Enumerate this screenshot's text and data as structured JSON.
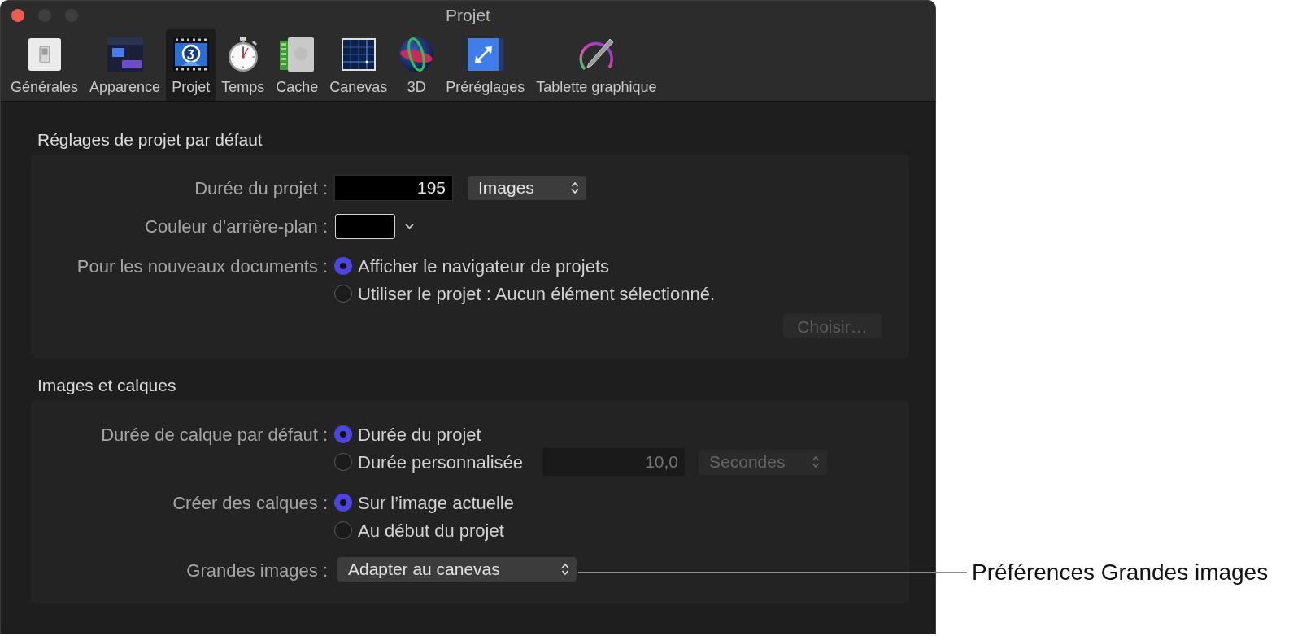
{
  "window": {
    "title": "Projet"
  },
  "toolbar": {
    "items": [
      {
        "label": "Générales",
        "selected": false
      },
      {
        "label": "Apparence",
        "selected": false
      },
      {
        "label": "Projet",
        "selected": true
      },
      {
        "label": "Temps",
        "selected": false
      },
      {
        "label": "Cache",
        "selected": false
      },
      {
        "label": "Canevas",
        "selected": false
      },
      {
        "label": "3D",
        "selected": false
      },
      {
        "label": "Préréglages",
        "selected": false
      },
      {
        "label": "Tablette graphique",
        "selected": false
      }
    ]
  },
  "sections": [
    {
      "title": "Réglages de projet par défaut",
      "rows": [
        {
          "kind": "number",
          "label": "Durée du projet :",
          "field": {
            "value": "195",
            "disabled": false
          },
          "popup": {
            "value": "Images",
            "disabled": false
          }
        },
        {
          "kind": "color",
          "label": "Couleur d’arrière-plan :",
          "color": "#000000"
        },
        {
          "kind": "radio",
          "label": "Pour les nouveaux documents :",
          "options": [
            {
              "label": "Afficher le navigateur de projets",
              "selected": true
            },
            {
              "label": "Utiliser le projet : Aucun élément sélectionné.",
              "selected": false
            }
          ],
          "button": {
            "label": "Choisir…",
            "disabled": true
          }
        }
      ]
    },
    {
      "title": "Images et calques",
      "rows": [
        {
          "kind": "radio",
          "label": "Durée de calque par défaut :",
          "options": [
            {
              "label": "Durée du projet",
              "selected": true
            },
            {
              "label": "Durée personnalisée",
              "selected": false,
              "field": {
                "value": "10,0",
                "disabled": true
              },
              "popup": {
                "value": "Secondes",
                "disabled": true
              }
            }
          ]
        },
        {
          "kind": "radio",
          "label": "Créer des calques :",
          "options": [
            {
              "label": "Sur l’image actuelle",
              "selected": true
            },
            {
              "label": "Au début du projet",
              "selected": false
            }
          ]
        },
        {
          "kind": "popup",
          "label": "Grandes images :",
          "popup": {
            "value": "Adapter au canevas",
            "disabled": false
          }
        }
      ]
    }
  ],
  "callout": {
    "text": "Préférences Grandes images"
  }
}
